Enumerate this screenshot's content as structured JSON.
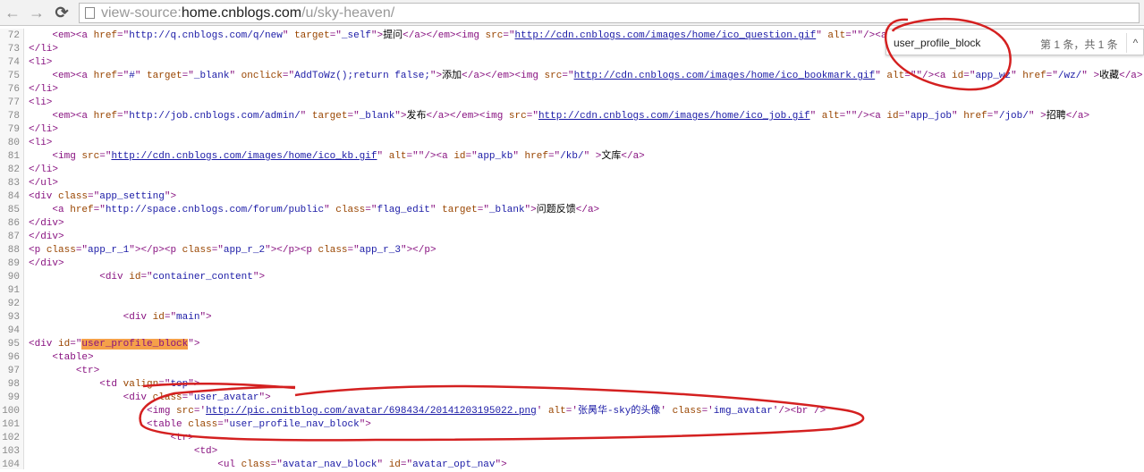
{
  "browser": {
    "url_scheme": "view-source:",
    "url_host": "home.cnblogs.com",
    "url_path": "/u/sky-heaven/",
    "back_icon": "←",
    "forward_icon": "→",
    "reload_icon": "⟳"
  },
  "find_bar": {
    "query": "user_profile_block",
    "count": "第 1 条，共 1 条",
    "prev_icon": "^"
  },
  "annotation_color": "#d42020",
  "highlight_color": "#f5a04a",
  "lines": [
    {
      "n": "72",
      "s": [
        [
          "x",
          "    "
        ],
        [
          "t",
          "<em><a "
        ],
        [
          "a",
          "href"
        ],
        [
          "t",
          "=\""
        ],
        [
          "v",
          "http://q.cnblogs.com/q/new"
        ],
        [
          "t",
          "\" "
        ],
        [
          "a",
          "target"
        ],
        [
          "t",
          "=\""
        ],
        [
          "v",
          "_self"
        ],
        [
          "t",
          "\">"
        ],
        [
          "x",
          "提问"
        ],
        [
          "t",
          "</a></em><img "
        ],
        [
          "a",
          "src"
        ],
        [
          "t",
          "=\""
        ],
        [
          "l",
          "http://cdn.cnblogs.com/images/home/ico_question.gif"
        ],
        [
          "t",
          "\" "
        ],
        [
          "a",
          "alt"
        ],
        [
          "t",
          "=\"\"/><a i"
        ]
      ]
    },
    {
      "n": "73",
      "s": [
        [
          "t",
          "</li>"
        ]
      ]
    },
    {
      "n": "74",
      "s": [
        [
          "t",
          "<li>"
        ]
      ]
    },
    {
      "n": "75",
      "s": [
        [
          "x",
          "    "
        ],
        [
          "t",
          "<em><a "
        ],
        [
          "a",
          "href"
        ],
        [
          "t",
          "=\""
        ],
        [
          "v",
          "#"
        ],
        [
          "t",
          "\" "
        ],
        [
          "a",
          "target"
        ],
        [
          "t",
          "=\""
        ],
        [
          "v",
          "_blank"
        ],
        [
          "t",
          "\" "
        ],
        [
          "a",
          "onclick"
        ],
        [
          "t",
          "=\""
        ],
        [
          "v",
          "AddToWz();return false;"
        ],
        [
          "t",
          "\">"
        ],
        [
          "x",
          "添加"
        ],
        [
          "t",
          "</a></em><img "
        ],
        [
          "a",
          "src"
        ],
        [
          "t",
          "=\""
        ],
        [
          "l",
          "http://cdn.cnblogs.com/images/home/ico_bookmark.gif"
        ],
        [
          "t",
          "\" "
        ],
        [
          "a",
          "alt"
        ],
        [
          "t",
          "=\"\"/><a "
        ],
        [
          "a",
          "id"
        ],
        [
          "t",
          "=\""
        ],
        [
          "v",
          "app_wz"
        ],
        [
          "t",
          "\" "
        ],
        [
          "a",
          "href"
        ],
        [
          "t",
          "=\""
        ],
        [
          "v",
          "/wz/"
        ],
        [
          "t",
          "\" >"
        ],
        [
          "x",
          "收藏"
        ],
        [
          "t",
          "</a>"
        ]
      ]
    },
    {
      "n": "76",
      "s": [
        [
          "t",
          "</li>"
        ]
      ]
    },
    {
      "n": "77",
      "s": [
        [
          "t",
          "<li>"
        ]
      ]
    },
    {
      "n": "78",
      "s": [
        [
          "x",
          "    "
        ],
        [
          "t",
          "<em><a "
        ],
        [
          "a",
          "href"
        ],
        [
          "t",
          "=\""
        ],
        [
          "v",
          "http://job.cnblogs.com/admin/"
        ],
        [
          "t",
          "\" "
        ],
        [
          "a",
          "target"
        ],
        [
          "t",
          "=\""
        ],
        [
          "v",
          "_blank"
        ],
        [
          "t",
          "\">"
        ],
        [
          "x",
          "发布"
        ],
        [
          "t",
          "</a></em><img "
        ],
        [
          "a",
          "src"
        ],
        [
          "t",
          "=\""
        ],
        [
          "l",
          "http://cdn.cnblogs.com/images/home/ico_job.gif"
        ],
        [
          "t",
          "\" "
        ],
        [
          "a",
          "alt"
        ],
        [
          "t",
          "=\"\"/><a "
        ],
        [
          "a",
          "id"
        ],
        [
          "t",
          "=\""
        ],
        [
          "v",
          "app_job"
        ],
        [
          "t",
          "\" "
        ],
        [
          "a",
          "href"
        ],
        [
          "t",
          "=\""
        ],
        [
          "v",
          "/job/"
        ],
        [
          "t",
          "\" >"
        ],
        [
          "x",
          "招聘"
        ],
        [
          "t",
          "</a>"
        ]
      ]
    },
    {
      "n": "79",
      "s": [
        [
          "t",
          "</li>"
        ]
      ]
    },
    {
      "n": "80",
      "s": [
        [
          "t",
          "<li>"
        ]
      ]
    },
    {
      "n": "81",
      "s": [
        [
          "x",
          "    "
        ],
        [
          "t",
          "<img "
        ],
        [
          "a",
          "src"
        ],
        [
          "t",
          "=\""
        ],
        [
          "l",
          "http://cdn.cnblogs.com/images/home/ico_kb.gif"
        ],
        [
          "t",
          "\" "
        ],
        [
          "a",
          "alt"
        ],
        [
          "t",
          "=\"\"/><a "
        ],
        [
          "a",
          "id"
        ],
        [
          "t",
          "=\""
        ],
        [
          "v",
          "app_kb"
        ],
        [
          "t",
          "\" "
        ],
        [
          "a",
          "href"
        ],
        [
          "t",
          "=\""
        ],
        [
          "v",
          "/kb/"
        ],
        [
          "t",
          "\" >"
        ],
        [
          "x",
          "文库"
        ],
        [
          "t",
          "</a>"
        ]
      ]
    },
    {
      "n": "82",
      "s": [
        [
          "t",
          "</li>"
        ]
      ]
    },
    {
      "n": "83",
      "s": [
        [
          "t",
          "</ul>"
        ]
      ]
    },
    {
      "n": "84",
      "s": [
        [
          "t",
          "<div "
        ],
        [
          "a",
          "class"
        ],
        [
          "t",
          "=\""
        ],
        [
          "v",
          "app_setting"
        ],
        [
          "t",
          "\">"
        ]
      ]
    },
    {
      "n": "85",
      "s": [
        [
          "x",
          "    "
        ],
        [
          "t",
          "<a "
        ],
        [
          "a",
          "href"
        ],
        [
          "t",
          "=\""
        ],
        [
          "v",
          "http://space.cnblogs.com/forum/public"
        ],
        [
          "t",
          "\" "
        ],
        [
          "a",
          "class"
        ],
        [
          "t",
          "=\""
        ],
        [
          "v",
          "flag_edit"
        ],
        [
          "t",
          "\" "
        ],
        [
          "a",
          "target"
        ],
        [
          "t",
          "=\""
        ],
        [
          "v",
          "_blank"
        ],
        [
          "t",
          "\">"
        ],
        [
          "x",
          "问题反馈"
        ],
        [
          "t",
          "</a>"
        ]
      ]
    },
    {
      "n": "86",
      "s": [
        [
          "t",
          "</div>"
        ]
      ]
    },
    {
      "n": "87",
      "s": [
        [
          "t",
          "</div>"
        ]
      ]
    },
    {
      "n": "88",
      "s": [
        [
          "t",
          "<p "
        ],
        [
          "a",
          "class"
        ],
        [
          "t",
          "=\""
        ],
        [
          "v",
          "app_r_1"
        ],
        [
          "t",
          "\"></p><p "
        ],
        [
          "a",
          "class"
        ],
        [
          "t",
          "=\""
        ],
        [
          "v",
          "app_r_2"
        ],
        [
          "t",
          "\"></p><p "
        ],
        [
          "a",
          "class"
        ],
        [
          "t",
          "=\""
        ],
        [
          "v",
          "app_r_3"
        ],
        [
          "t",
          "\"></p>"
        ]
      ]
    },
    {
      "n": "89",
      "s": [
        [
          "t",
          "</div>"
        ]
      ]
    },
    {
      "n": "90",
      "s": [
        [
          "x",
          "            "
        ],
        [
          "t",
          "<div "
        ],
        [
          "a",
          "id"
        ],
        [
          "t",
          "=\""
        ],
        [
          "v",
          "container_content"
        ],
        [
          "t",
          "\">"
        ]
      ]
    },
    {
      "n": "91",
      "s": []
    },
    {
      "n": "92",
      "s": []
    },
    {
      "n": "93",
      "s": [
        [
          "x",
          "                "
        ],
        [
          "t",
          "<div "
        ],
        [
          "a",
          "id"
        ],
        [
          "t",
          "=\""
        ],
        [
          "v",
          "main"
        ],
        [
          "t",
          "\">"
        ]
      ]
    },
    {
      "n": "94",
      "s": []
    },
    {
      "n": "95",
      "s": [
        [
          "t",
          "<div "
        ],
        [
          "a",
          "id"
        ],
        [
          "t",
          "=\""
        ],
        [
          "h",
          "user_profile_block"
        ],
        [
          "t",
          "\">"
        ]
      ]
    },
    {
      "n": "96",
      "s": [
        [
          "x",
          "    "
        ],
        [
          "t",
          "<table>"
        ]
      ]
    },
    {
      "n": "97",
      "s": [
        [
          "x",
          "        "
        ],
        [
          "t",
          "<tr>"
        ]
      ]
    },
    {
      "n": "98",
      "s": [
        [
          "x",
          "            "
        ],
        [
          "t",
          "<td "
        ],
        [
          "a",
          "valign"
        ],
        [
          "t",
          "=\""
        ],
        [
          "v",
          "top"
        ],
        [
          "t",
          "\">"
        ]
      ]
    },
    {
      "n": "99",
      "s": [
        [
          "x",
          "                "
        ],
        [
          "t",
          "<div "
        ],
        [
          "a",
          "class"
        ],
        [
          "t",
          "=\""
        ],
        [
          "v",
          "user_avatar"
        ],
        [
          "t",
          "\">"
        ]
      ]
    },
    {
      "n": "100",
      "s": [
        [
          "x",
          "                    "
        ],
        [
          "t",
          "<img "
        ],
        [
          "a",
          "src"
        ],
        [
          "t",
          "='"
        ],
        [
          "l",
          "http://pic.cnitblog.com/avatar/698434/20141203195022.png"
        ],
        [
          "t",
          "' "
        ],
        [
          "a",
          "alt"
        ],
        [
          "t",
          "='"
        ],
        [
          "v",
          "张昺华-sky的头像"
        ],
        [
          "t",
          "' "
        ],
        [
          "a",
          "class"
        ],
        [
          "t",
          "='"
        ],
        [
          "v",
          "img_avatar"
        ],
        [
          "t",
          "'/><br />"
        ]
      ]
    },
    {
      "n": "101",
      "s": [
        [
          "x",
          "                    "
        ],
        [
          "t",
          "<table "
        ],
        [
          "a",
          "class"
        ],
        [
          "t",
          "=\""
        ],
        [
          "v",
          "user_profile_nav_block"
        ],
        [
          "t",
          "\">"
        ]
      ]
    },
    {
      "n": "102",
      "s": [
        [
          "x",
          "                        "
        ],
        [
          "t",
          "<tr>"
        ]
      ]
    },
    {
      "n": "103",
      "s": [
        [
          "x",
          "                            "
        ],
        [
          "t",
          "<td>"
        ]
      ]
    },
    {
      "n": "104",
      "s": [
        [
          "x",
          "                                "
        ],
        [
          "t",
          "<ul "
        ],
        [
          "a",
          "class"
        ],
        [
          "t",
          "=\""
        ],
        [
          "v",
          "avatar_nav_block"
        ],
        [
          "t",
          "\" "
        ],
        [
          "a",
          "id"
        ],
        [
          "t",
          "=\""
        ],
        [
          "v",
          "avatar_opt_nav"
        ],
        [
          "t",
          "\">"
        ]
      ]
    }
  ]
}
